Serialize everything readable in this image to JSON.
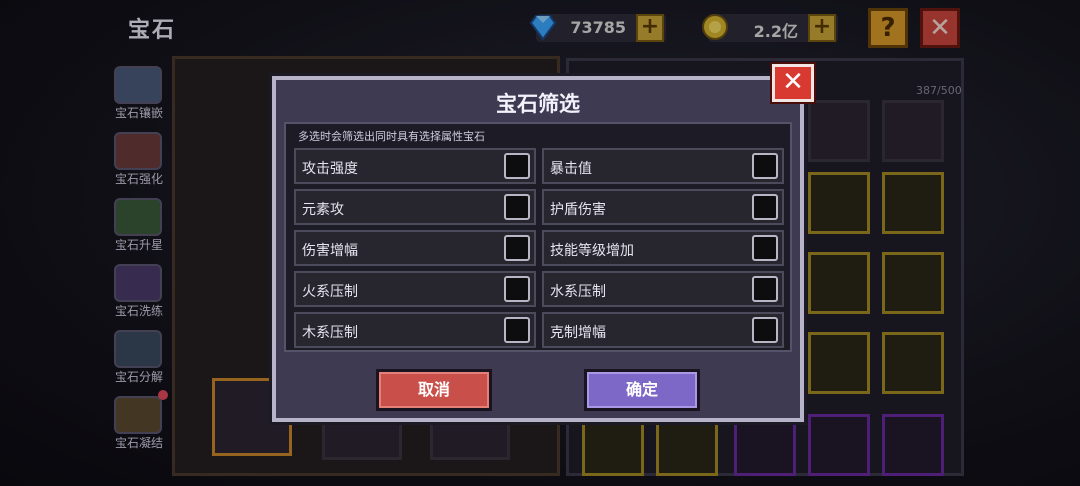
{
  "header": {
    "title": "宝石",
    "diamonds": {
      "icon": "diamond-icon",
      "value": "73785"
    },
    "gold": {
      "icon": "coin-icon",
      "value": "2.2亿"
    },
    "plus": "+",
    "help": "?",
    "close": "✕"
  },
  "sidebar": {
    "items": [
      {
        "label": "宝石镶嵌",
        "icon": "gem-inlay-icon"
      },
      {
        "label": "宝石强化",
        "icon": "gem-enhance-icon"
      },
      {
        "label": "宝石升星",
        "icon": "star-icon"
      },
      {
        "label": "宝石洗练",
        "icon": "gem-refine-icon"
      },
      {
        "label": "宝石分解",
        "icon": "gem-decompose-icon"
      },
      {
        "label": "宝石凝结",
        "icon": "gem-condense-icon"
      }
    ]
  },
  "inventory": {
    "capacity": "387/500"
  },
  "filter_modal": {
    "title": "宝石筛选",
    "close": "✕",
    "hint": "多选时会筛选出同时具有选择属性宝石",
    "options": [
      {
        "label": "攻击强度",
        "checked": false
      },
      {
        "label": "暴击值",
        "checked": false
      },
      {
        "label": "元素攻",
        "checked": false
      },
      {
        "label": "护盾伤害",
        "checked": false
      },
      {
        "label": "伤害增幅",
        "checked": false
      },
      {
        "label": "技能等级增加",
        "checked": false
      },
      {
        "label": "火系压制",
        "checked": false
      },
      {
        "label": "水系压制",
        "checked": false
      },
      {
        "label": "木系压制",
        "checked": false
      },
      {
        "label": "克制增幅",
        "checked": false
      }
    ],
    "cancel_label": "取消",
    "confirm_label": "确定"
  },
  "colors": {
    "accent_confirm": "#7d68c8",
    "accent_cancel": "#c9504a",
    "close_red": "#d83a32"
  }
}
